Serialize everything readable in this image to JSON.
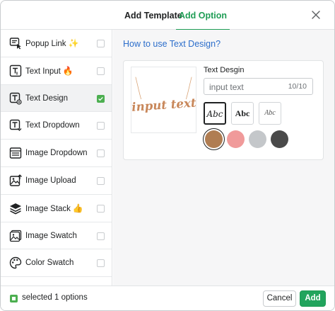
{
  "tabs": [
    {
      "label": "Add Template",
      "active": false
    },
    {
      "label": "Add Option",
      "active": true
    }
  ],
  "sidebar": {
    "items": [
      {
        "label": "Popup Link",
        "icon": "popup-link-icon",
        "emoji": "✨",
        "checked": false
      },
      {
        "label": "Text Input",
        "icon": "text-input-icon",
        "emoji": "🔥",
        "checked": false
      },
      {
        "label": "Text Design",
        "icon": "text-design-icon",
        "emoji": "",
        "checked": true
      },
      {
        "label": "Text Dropdown",
        "icon": "text-dropdown-icon",
        "emoji": "",
        "checked": false
      },
      {
        "label": "Image Dropdown",
        "icon": "image-dropdown-icon",
        "emoji": "",
        "checked": false
      },
      {
        "label": "Image Upload",
        "icon": "image-upload-icon",
        "emoji": "",
        "checked": false
      },
      {
        "label": "Image Stack",
        "icon": "image-stack-icon",
        "emoji": "👍",
        "checked": false
      },
      {
        "label": "Image Swatch",
        "icon": "image-swatch-icon",
        "emoji": "",
        "checked": false
      },
      {
        "label": "Color Swatch",
        "icon": "palette-icon",
        "emoji": "",
        "checked": false
      }
    ]
  },
  "content": {
    "help_link": "How to use Text Design?",
    "preview_text": "input text",
    "field_title": "Text Desgin",
    "input": {
      "value": "input text",
      "count": "10/10"
    },
    "font_options": [
      {
        "sample": "Abc",
        "style": "script",
        "active": true
      },
      {
        "sample": "Abc",
        "style": "bold-serif",
        "active": false
      },
      {
        "sample": "Abc",
        "style": "thin-script",
        "active": false
      }
    ],
    "color_swatches": [
      {
        "color": "#b07d52",
        "active": true
      },
      {
        "color": "#f09a9a",
        "active": false
      },
      {
        "color": "#c4c7ca",
        "active": false
      },
      {
        "color": "#4a4a4a",
        "active": false
      }
    ]
  },
  "footer": {
    "selected_text": "selected 1 options",
    "cancel_label": "Cancel",
    "add_label": "Add"
  },
  "colors": {
    "accent_green": "#22a45d",
    "link_blue": "#2c6ecb",
    "preview_gold": "#c8875a"
  }
}
